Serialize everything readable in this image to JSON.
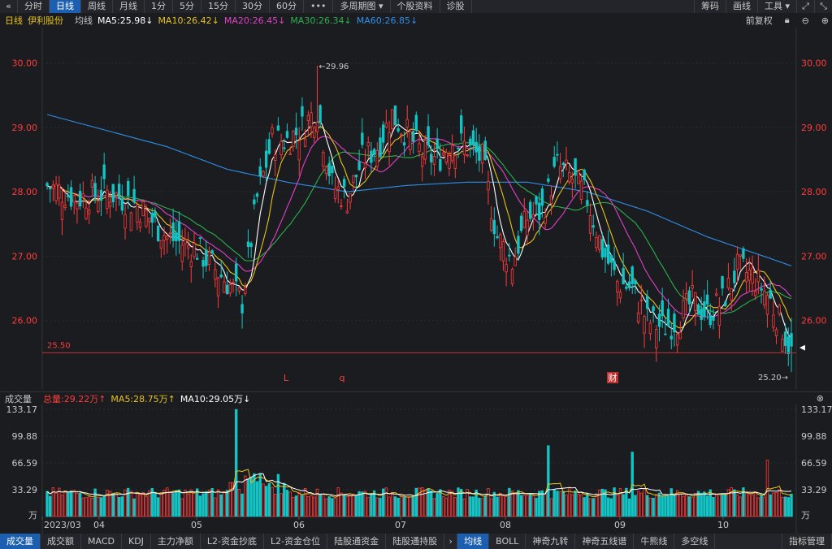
{
  "toolbar": {
    "left_icon": "«",
    "periods": [
      "分时",
      "日线",
      "周线",
      "月线",
      "1分",
      "5分",
      "15分",
      "30分",
      "60分",
      "•••",
      "多周期图 ▾",
      "个股资料",
      "诊股"
    ],
    "active_period": 1,
    "right": [
      "筹码",
      "画线",
      "工具 ▾"
    ]
  },
  "info": {
    "period": "日线",
    "stock_name": "伊利股份",
    "ma_label": "均线",
    "ma5": "MA5:25.98↓",
    "ma10": "MA10:26.42↓",
    "ma20": "MA20:26.45↓",
    "ma30": "MA30:26.34↓",
    "ma60": "MA60:26.85↓",
    "adjust": "前复权"
  },
  "price_axis": [
    "30.00",
    "29.00",
    "28.00",
    "27.00",
    "26.00"
  ],
  "markers": {
    "high": "←29.96",
    "low": "25.20→",
    "ref_line": "25.50",
    "events": [
      "L",
      "q",
      "财"
    ]
  },
  "volume": {
    "title": "成交量",
    "total": "总量:29.22万↑",
    "ma5": "MA5:28.75万↑",
    "ma10": "MA10:29.05万↓",
    "axis": [
      "133.17",
      "99.88",
      "66.59",
      "33.29",
      "万"
    ]
  },
  "date_axis": [
    "2023/03",
    "04",
    "05",
    "06",
    "07",
    "08",
    "09",
    "10"
  ],
  "bottom_tabs": {
    "left": [
      "成交量",
      "成交额",
      "MACD",
      "KDJ",
      "主力净额",
      "L2-资金抄底",
      "L2-资金仓位",
      "陆股通资金",
      "陆股通持股"
    ],
    "arrow": "›",
    "right": [
      "均线",
      "BOLL",
      "神奇九转",
      "神奇五线谱",
      "牛熊线",
      "多空线"
    ],
    "end": "指标管理"
  },
  "colors": {
    "up": "#ff3b3b",
    "down": "#14c3c3",
    "ma5": "#ffffff",
    "ma10": "#e8c31b",
    "ma20": "#e040c8",
    "ma30": "#2bb24c",
    "ma60": "#2f8ee8"
  },
  "chart_data": {
    "type": "candlestick",
    "x_range": [
      "2023/03",
      "10"
    ],
    "ylim": [
      25.0,
      30.5
    ],
    "series_points": {
      "close": [
        [
          0,
          28.1
        ],
        [
          10,
          27.9
        ],
        [
          20,
          28.0
        ],
        [
          30,
          27.8
        ],
        [
          40,
          27.3
        ],
        [
          50,
          27.1
        ],
        [
          60,
          26.6
        ],
        [
          65,
          26.3
        ],
        [
          70,
          27.9
        ],
        [
          75,
          28.8
        ],
        [
          80,
          28.8
        ],
        [
          85,
          29.0
        ],
        [
          90,
          29.3
        ],
        [
          95,
          28.1
        ],
        [
          100,
          27.9
        ],
        [
          105,
          28.5
        ],
        [
          110,
          28.7
        ],
        [
          115,
          29.2
        ],
        [
          120,
          28.9
        ],
        [
          125,
          28.6
        ],
        [
          130,
          28.5
        ],
        [
          135,
          28.8
        ],
        [
          140,
          28.7
        ],
        [
          145,
          28.5
        ],
        [
          150,
          27.3
        ],
        [
          155,
          26.9
        ],
        [
          160,
          27.6
        ],
        [
          165,
          27.7
        ],
        [
          170,
          28.4
        ],
        [
          175,
          28.2
        ],
        [
          180,
          27.9
        ],
        [
          185,
          27.1
        ],
        [
          190,
          26.6
        ],
        [
          195,
          26.5
        ],
        [
          200,
          26.0
        ],
        [
          205,
          25.9
        ],
        [
          210,
          26.0
        ],
        [
          215,
          26.3
        ],
        [
          220,
          26.1
        ],
        [
          225,
          26.3
        ],
        [
          230,
          26.8
        ],
        [
          235,
          26.7
        ],
        [
          240,
          26.4
        ],
        [
          245,
          25.9
        ],
        [
          248,
          25.5
        ]
      ],
      "ma60": [
        [
          0,
          29.2
        ],
        [
          20,
          28.95
        ],
        [
          40,
          28.7
        ],
        [
          60,
          28.35
        ],
        [
          80,
          28.15
        ],
        [
          100,
          28.0
        ],
        [
          120,
          28.1
        ],
        [
          140,
          28.15
        ],
        [
          160,
          28.15
        ],
        [
          180,
          28.0
        ],
        [
          200,
          27.7
        ],
        [
          220,
          27.3
        ],
        [
          240,
          26.98
        ],
        [
          248,
          26.85
        ]
      ]
    }
  }
}
